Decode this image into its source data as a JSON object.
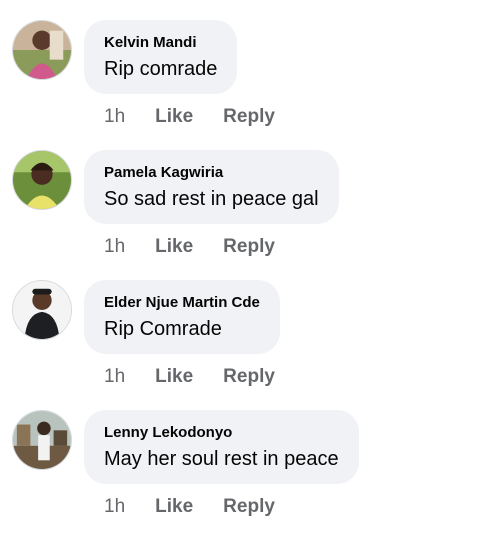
{
  "comments": [
    {
      "author": "Kelvin Mandi",
      "text": "Rip comrade",
      "time": "1h",
      "like_label": "Like",
      "reply_label": "Reply"
    },
    {
      "author": "Pamela Kagwiria",
      "text": "So sad rest in peace gal",
      "time": "1h",
      "like_label": "Like",
      "reply_label": "Reply"
    },
    {
      "author": "Elder Njue Martin Cde",
      "text": "Rip Comrade",
      "time": "1h",
      "like_label": "Like",
      "reply_label": "Reply"
    },
    {
      "author": "Lenny Lekodonyo",
      "text": "May her soul rest in peace",
      "time": "1h",
      "like_label": "Like",
      "reply_label": "Reply"
    }
  ],
  "colors": {
    "bubble_background": "#f0f2f5",
    "text": "#050505",
    "secondary_text": "#65676b"
  }
}
